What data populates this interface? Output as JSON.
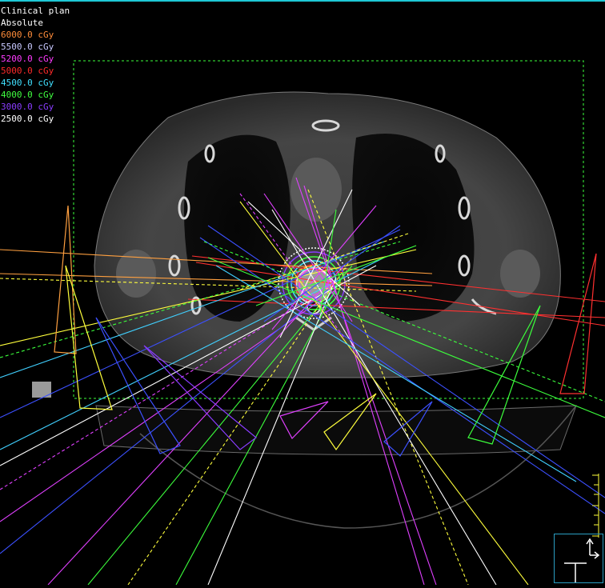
{
  "viewer": {
    "plan_title": "Clinical plan",
    "dose_mode": "Absolute"
  },
  "isodose_levels": [
    {
      "label": "6000.0 cGy",
      "color": "#ff8c3a"
    },
    {
      "label": "5500.0 cGy",
      "color": "#c8c8ff"
    },
    {
      "label": "5200.0 cGy",
      "color": "#ff3cff"
    },
    {
      "label": "5000.0 cGy",
      "color": "#ff2a2a"
    },
    {
      "label": "4500.0 cGy",
      "color": "#40e0ff"
    },
    {
      "label": "4000.0 cGy",
      "color": "#40ff40"
    },
    {
      "label": "3000.0 cGy",
      "color": "#8a3cff"
    },
    {
      "label": "2500.0 cGy",
      "color": "#ffffff"
    }
  ],
  "beam_colors": {
    "yellow": "#ffff3c",
    "green": "#3cff3c",
    "magenta": "#e040ff",
    "blue": "#3c50ff",
    "red": "#ff3030",
    "orange": "#ffa040",
    "cyan": "#40d0ff",
    "white": "#ffffff"
  },
  "icons": {
    "orientation": "axis-orientation-icon",
    "ruler": "scale-ruler-icon"
  }
}
